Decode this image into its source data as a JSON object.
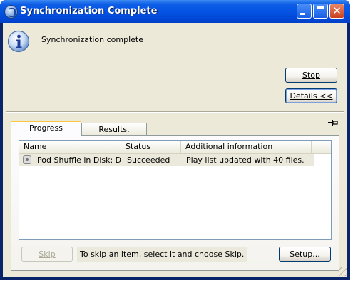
{
  "window": {
    "title": "Synchronization Complete"
  },
  "message": "Synchronization complete",
  "buttons": {
    "stop": "Stop",
    "details": "Details <<",
    "skip": "Skip",
    "setup": "Setup..."
  },
  "tabs": [
    {
      "label": "Progress"
    },
    {
      "label": "Results."
    }
  ],
  "table": {
    "columns": [
      "Name",
      "Status",
      "Additional information"
    ],
    "rows": [
      {
        "name": "iPod Shuffle in Disk: D",
        "status": "Succeeded",
        "info": "Play list updated with 40 files."
      }
    ]
  },
  "hint": "To skip an item, select it and choose Skip.",
  "colors": {
    "title_bar": "#0554e3",
    "client_bg": "#ece9d8",
    "tab_accent": "#ffc83c"
  }
}
